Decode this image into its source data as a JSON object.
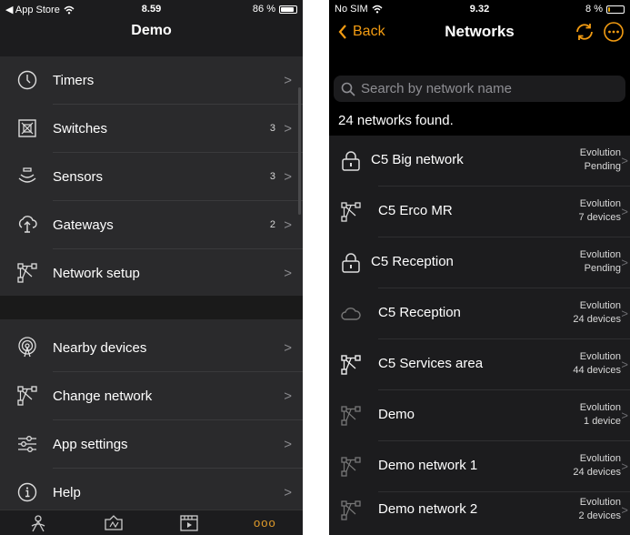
{
  "left": {
    "status": {
      "back_app": "◀ App Store",
      "time": "8.59",
      "battery": "86 %",
      "battery_level": 0.86
    },
    "title": "Demo",
    "menu_group1": [
      {
        "label": "Timers",
        "count": "",
        "icon": "clock-icon"
      },
      {
        "label": "Switches",
        "count": "3",
        "icon": "switch-icon"
      },
      {
        "label": "Sensors",
        "count": "3",
        "icon": "sensor-icon"
      },
      {
        "label": "Gateways",
        "count": "2",
        "icon": "gateway-icon"
      },
      {
        "label": "Network setup",
        "count": "",
        "icon": "network-icon"
      }
    ],
    "menu_group2": [
      {
        "label": "Nearby devices",
        "icon": "nearby-icon"
      },
      {
        "label": "Change network",
        "icon": "network-icon"
      },
      {
        "label": "App settings",
        "icon": "sliders-icon"
      },
      {
        "label": "Help",
        "icon": "info-icon"
      }
    ],
    "chevron": ">",
    "tabbar": {
      "tabs": [
        "locate-icon",
        "map-icon",
        "scenes-icon",
        "more-icon"
      ],
      "more_label": "ooo",
      "active_color": "#e09b2a"
    }
  },
  "right": {
    "status": {
      "carrier": "No SIM",
      "time": "9.32",
      "battery": "8 %",
      "battery_level": 0.08
    },
    "back_label": "Back",
    "title": "Networks",
    "accent_color": "#f39c12",
    "search": {
      "placeholder": "Search by network name",
      "value": ""
    },
    "found_text": "24 networks found.",
    "chevron": ">",
    "networks": [
      {
        "name": "C5 Big network",
        "type": "Evolution",
        "status": "Pending",
        "icon": "lock-icon",
        "locked": true
      },
      {
        "name": "C5 Erco MR",
        "type": "Evolution",
        "status": "7 devices",
        "icon": "network-icon",
        "locked": false
      },
      {
        "name": "C5 Reception",
        "type": "Evolution",
        "status": "Pending",
        "icon": "lock-icon",
        "locked": true
      },
      {
        "name": "C5 Reception",
        "type": "Evolution",
        "status": "24 devices",
        "icon": "cloud-icon",
        "locked": false
      },
      {
        "name": "C5 Services area",
        "type": "Evolution",
        "status": "44 devices",
        "icon": "network-icon",
        "locked": false
      },
      {
        "name": "Demo",
        "type": "Evolution",
        "status": "1 device",
        "icon": "network-icon",
        "locked": false
      },
      {
        "name": "Demo network 1",
        "type": "Evolution",
        "status": "24 devices",
        "icon": "network-icon",
        "locked": false
      },
      {
        "name": "Demo network 2",
        "type": "Evolution",
        "status": "2 devices",
        "icon": "network-icon",
        "locked": false
      }
    ]
  }
}
